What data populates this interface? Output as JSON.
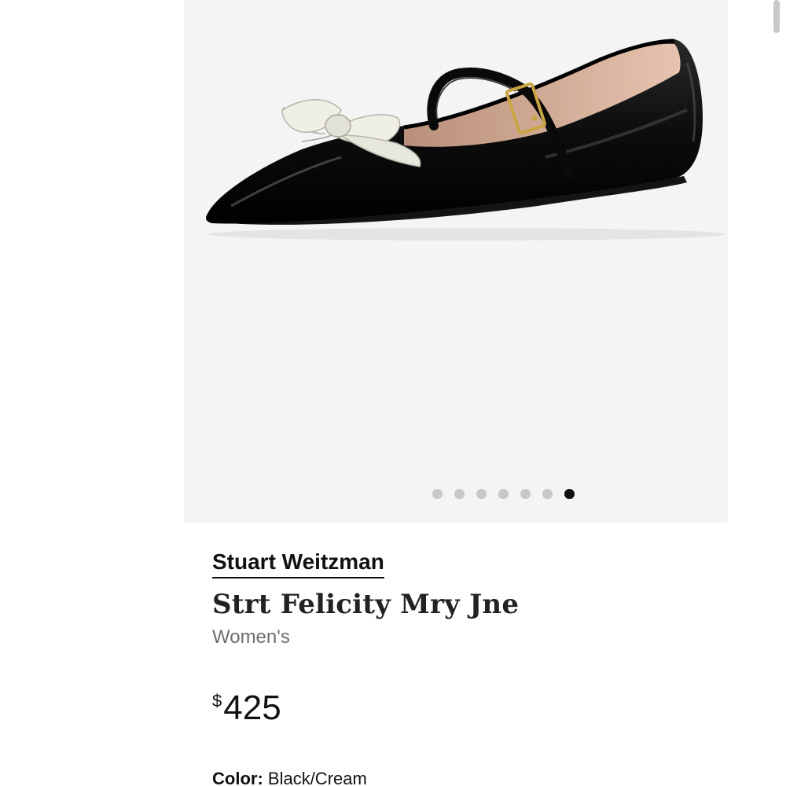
{
  "gallery": {
    "image_alt": "Black patent pointed-toe Mary Jane flat with cream bow",
    "dots_total": 7,
    "active_dot_index": 6,
    "colors": {
      "background": "#f4f4f4",
      "dot_inactive": "#c8c8c8",
      "dot_active": "#111111"
    }
  },
  "product": {
    "brand": "Stuart Weitzman",
    "name": "Strt Felicity Mry Jne",
    "gender": "Women's",
    "price_currency": "$",
    "price_amount": "425",
    "color_label": "Color:",
    "color_value": "Black/Cream"
  }
}
